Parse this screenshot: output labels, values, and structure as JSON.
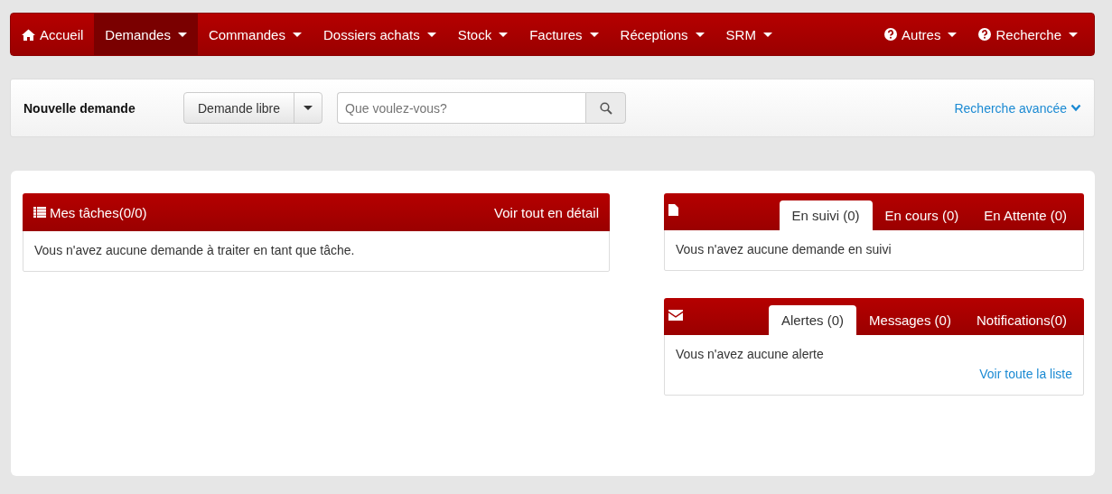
{
  "navbar": {
    "items": [
      {
        "label": "Accueil",
        "kind": "home",
        "selected": false
      },
      {
        "label": "Demandes",
        "kind": "menu",
        "selected": true
      },
      {
        "label": "Commandes",
        "kind": "menu",
        "selected": false
      },
      {
        "label": "Dossiers achats",
        "kind": "menu",
        "selected": false
      },
      {
        "label": "Stock",
        "kind": "menu",
        "selected": false
      },
      {
        "label": "Factures",
        "kind": "menu",
        "selected": false
      },
      {
        "label": "Réceptions",
        "kind": "menu",
        "selected": false
      },
      {
        "label": "SRM",
        "kind": "menu",
        "selected": false
      }
    ],
    "right_items": [
      {
        "label": "Autres",
        "kind": "help",
        "selected": false
      },
      {
        "label": "Recherche",
        "kind": "help",
        "selected": false
      }
    ]
  },
  "toolbar": {
    "title": "Nouvelle demande",
    "type_button": "Demande libre",
    "search": {
      "placeholder": "Que voulez-vous?"
    },
    "advanced_link": "Recherche avancée"
  },
  "tasks_panel": {
    "title": "Mes tâches(0/0)",
    "link": "Voir tout en détail",
    "message": "Vous n'avez aucune demande à traiter en tant que tâche."
  },
  "tab_panels": [
    {
      "tabs": [
        {
          "label": "En suivi (0)",
          "selected": true
        },
        {
          "label": "En cours (0)",
          "selected": false
        },
        {
          "label": "En Attente (0)",
          "selected": false
        }
      ],
      "message": "Vous n'avez aucune demande en suivi"
    },
    {
      "tabs": [
        {
          "label": "Alertes (0)",
          "selected": true
        },
        {
          "label": "Messages (0)",
          "selected": false
        },
        {
          "label": "Notifications(0)",
          "selected": false
        }
      ],
      "message": "Vous n'avez aucune alerte",
      "link": "Voir toute la liste"
    }
  ]
}
